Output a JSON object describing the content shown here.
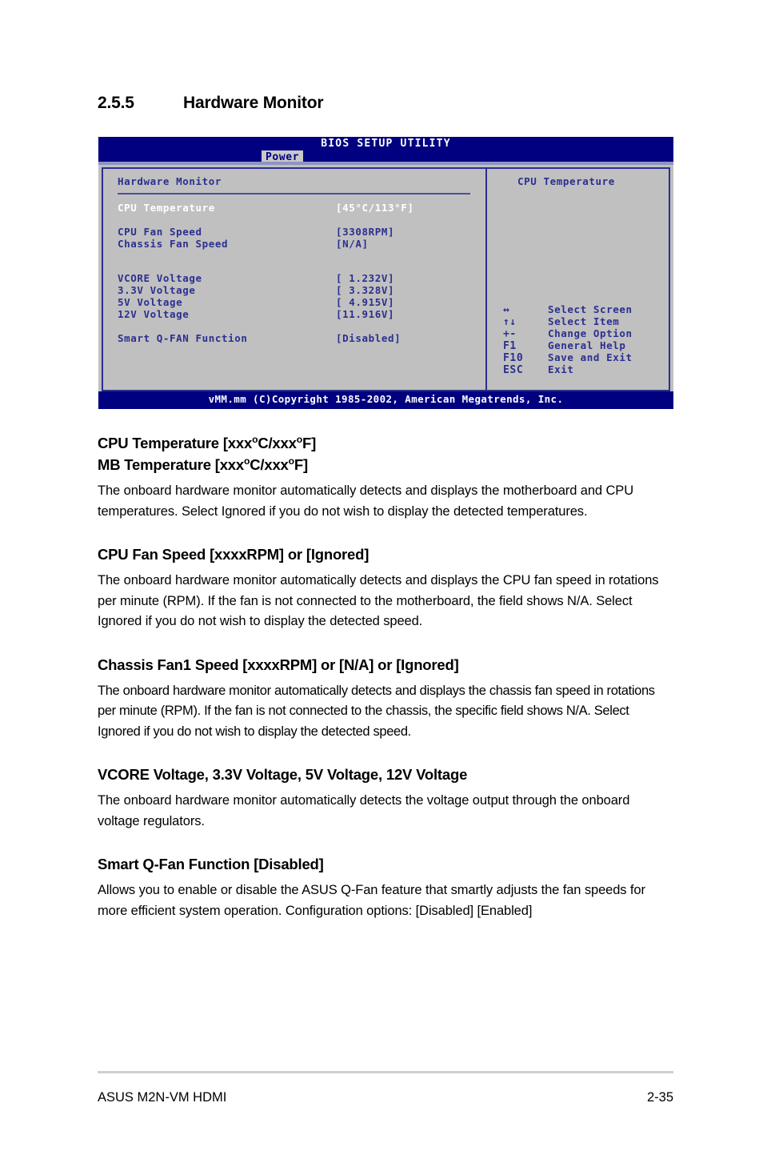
{
  "section": {
    "number": "2.5.5",
    "title": "Hardware Monitor"
  },
  "bios": {
    "window_title": "BIOS SETUP UTILITY",
    "active_tab": "Power",
    "panel_heading": "Hardware Monitor",
    "items": [
      {
        "label": "CPU Temperature",
        "value": "[45°C/113°F]",
        "selected": true
      },
      {
        "label": "CPU Fan Speed",
        "value": "[3308RPM]",
        "selected": false
      },
      {
        "label": "Chassis Fan Speed",
        "value": "[N/A]",
        "selected": false
      },
      {
        "label": "VCORE Voltage",
        "value": "[ 1.232V]",
        "selected": false
      },
      {
        "label": "3.3V Voltage",
        "value": "[ 3.328V]",
        "selected": false
      },
      {
        "label": "5V Voltage",
        "value": "[ 4.915V]",
        "selected": false
      },
      {
        "label": "12V Voltage",
        "value": "[11.916V]",
        "selected": false
      },
      {
        "label": "Smart Q-FAN Function",
        "value": "[Disabled]",
        "selected": false
      }
    ],
    "help_title": "CPU Temperature",
    "keys": [
      {
        "key": "↔",
        "desc": "Select Screen"
      },
      {
        "key": "↑↓",
        "desc": "Select Item"
      },
      {
        "key": "+-",
        "desc": "Change Option"
      },
      {
        "key": "F1",
        "desc": "General Help"
      },
      {
        "key": "F10",
        "desc": "Save and Exit"
      },
      {
        "key": "ESC",
        "desc": "Exit"
      }
    ],
    "copyright": "vMM.mm (C)Copyright 1985-2002, American Megatrends, Inc.",
    "colors": {
      "header_bg": "#000080",
      "panel_bg": "#c0c0c0",
      "text": "#2b2f8f",
      "selected_text": "#ffffff"
    }
  },
  "sections": [
    {
      "headings": [
        "CPU Temperature [xxx°C/xxx°F]",
        "MB Temperature [xxx°C/xxx°F]"
      ],
      "body": "The onboard hardware monitor automatically detects and displays the motherboard and CPU temperatures. Select Ignored if you do not wish to display the detected temperatures."
    },
    {
      "headings": [
        "CPU Fan Speed [xxxxRPM] or [Ignored]"
      ],
      "body": "The onboard hardware monitor automatically detects and displays the CPU fan speed in rotations per minute (RPM). If the fan is not connected to the motherboard, the field shows N/A. Select Ignored if you do not wish to display the detected speed."
    },
    {
      "headings": [
        "Chassis Fan1 Speed [xxxxRPM] or [N/A] or [Ignored]"
      ],
      "body": "The onboard hardware monitor automatically detects and displays the chassis fan speed in rotations per minute (RPM). If the fan is not connected to the chassis, the specific field shows N/A. Select Ignored if you do not wish to display the detected speed."
    },
    {
      "headings": [
        "VCORE Voltage, 3.3V Voltage, 5V Voltage, 12V Voltage"
      ],
      "body": "The onboard hardware monitor automatically detects the voltage output through the onboard voltage regulators."
    },
    {
      "headings": [
        "Smart Q-Fan Function [Disabled]"
      ],
      "body": "Allows you to enable or disable the ASUS Q-Fan feature that smartly adjusts the fan speeds for more efficient system operation. Configuration options: [Disabled] [Enabled]"
    }
  ],
  "footer": {
    "left": "ASUS M2N-VM HDMI",
    "right": "2-35"
  }
}
